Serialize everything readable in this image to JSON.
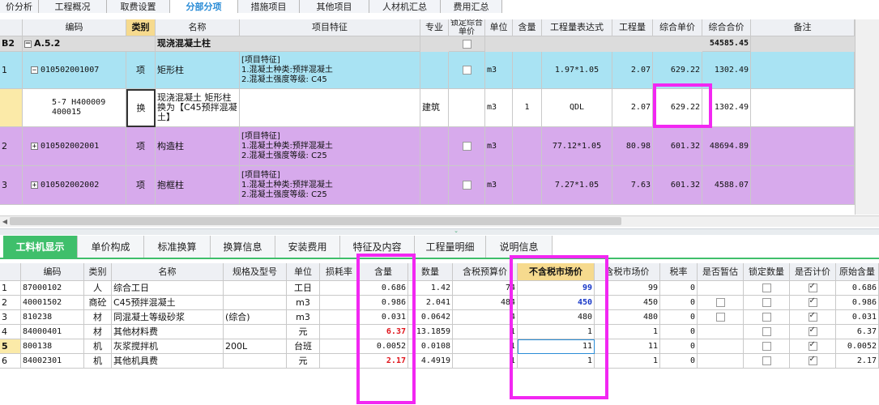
{
  "top_tabs": [
    "价分析",
    "工程概况",
    "取费设置",
    "分部分项",
    "措施项目",
    "其他项目",
    "人材机汇总",
    "费用汇总"
  ],
  "upper_headers": [
    "编码",
    "类别",
    "名称",
    "项目特征",
    "专业",
    "锁定综合单价",
    "单位",
    "含量",
    "工程量表达式",
    "工程量",
    "综合单价",
    "综合合价",
    "备注"
  ],
  "group_row": {
    "id": "B2",
    "code": "A.5.2",
    "name": "现浇混凝土柱",
    "total": "54585.45"
  },
  "rows": [
    {
      "num": "1",
      "code": "010502001007",
      "type": "项",
      "name": "矩形柱",
      "features": [
        "[项目特征]",
        "1.混凝土种类:预拌混凝土",
        "2.混凝土强度等级: C45"
      ],
      "unit": "m3",
      "expr": "1.97*1.05",
      "qty": "2.07",
      "price": "629.22",
      "total": "1302.49"
    },
    {
      "code": "5-7 H400009 400015",
      "type": "换",
      "name": "现浇混凝土 矩形柱 换为【C45预拌混凝土】",
      "specialty": "建筑",
      "unit": "m3",
      "content": "1",
      "expr": "QDL",
      "qty": "2.07",
      "price": "629.22",
      "total": "1302.49"
    },
    {
      "num": "2",
      "code": "010502002001",
      "type": "项",
      "name": "构造柱",
      "features": [
        "[项目特征]",
        "1.混凝土种类:预拌混凝土",
        "2.混凝土强度等级: C25"
      ],
      "unit": "m3",
      "expr": "77.12*1.05",
      "qty": "80.98",
      "price": "601.32",
      "total": "48694.89"
    },
    {
      "num": "3",
      "code": "010502002002",
      "type": "项",
      "name": "抱框柱",
      "features": [
        "[项目特征]",
        "1.混凝土种类:预拌混凝土",
        "2.混凝土强度等级: C25"
      ],
      "unit": "m3",
      "expr": "7.27*1.05",
      "qty": "7.63",
      "price": "601.32",
      "total": "4588.07"
    }
  ],
  "bottom_tabs": [
    "工料机显示",
    "单价构成",
    "标准换算",
    "换算信息",
    "安装费用",
    "特征及内容",
    "工程量明细",
    "说明信息"
  ],
  "lower_headers": [
    "编码",
    "类别",
    "名称",
    "规格及型号",
    "单位",
    "损耗率",
    "含量",
    "数量",
    "含税预算价",
    "不含税市场价",
    "含税市场价",
    "税率",
    "是否暂估",
    "锁定数量",
    "是否计价",
    "原始含量"
  ],
  "materials": [
    {
      "num": "1",
      "code": "87000102",
      "type": "人",
      "name": "综合工日",
      "spec": "",
      "unit": "工日",
      "content": "0.686",
      "qty": "1.42",
      "budget": "74",
      "market": "99",
      "market_tax": "99",
      "rate": "0",
      "estimate": false,
      "priced": true,
      "orig": "0.686"
    },
    {
      "num": "2",
      "code": "40001502",
      "type": "商砼",
      "name": "C45预拌混凝土",
      "spec": "",
      "unit": "m3",
      "content": "0.986",
      "qty": "2.041",
      "budget": "484",
      "market": "450",
      "market_tax": "450",
      "rate": "0",
      "estimate": true,
      "priced": true,
      "orig": "0.986"
    },
    {
      "num": "3",
      "code": "810238",
      "type": "材",
      "name": "同混凝土等级砂浆",
      "spec": "(综合)",
      "unit": "m3",
      "content": "0.031",
      "qty": "0.0642",
      "budget": "4",
      "market": "480",
      "market_tax": "480",
      "rate": "0",
      "estimate": true,
      "priced": true,
      "orig": "0.031"
    },
    {
      "num": "4",
      "code": "84000401",
      "type": "材",
      "name": "其他材料费",
      "spec": "",
      "unit": "元",
      "content": "6.37",
      "qty": "13.1859",
      "budget": "1",
      "market": "1",
      "market_tax": "1",
      "rate": "0",
      "estimate": false,
      "priced": true,
      "orig": "6.37"
    },
    {
      "num": "5",
      "code": "800138",
      "type": "机",
      "name": "灰浆搅拌机",
      "spec": "200L",
      "unit": "台班",
      "content": "0.0052",
      "qty": "0.0108",
      "budget": "1",
      "market": "11",
      "market_tax": "11",
      "rate": "0",
      "estimate": false,
      "priced": true,
      "orig": "0.0052"
    },
    {
      "num": "6",
      "code": "84002301",
      "type": "机",
      "name": "其他机具费",
      "spec": "",
      "unit": "元",
      "content": "2.17",
      "qty": "4.4919",
      "budget": "1",
      "market": "1",
      "market_tax": "1",
      "rate": "0",
      "estimate": false,
      "priced": true,
      "orig": "2.17"
    }
  ],
  "colors": {
    "highlight": "#f227f2",
    "item_row": "#a9e3f3",
    "purple_row": "#d7aaec",
    "active_tab": "#3fbf6b"
  }
}
